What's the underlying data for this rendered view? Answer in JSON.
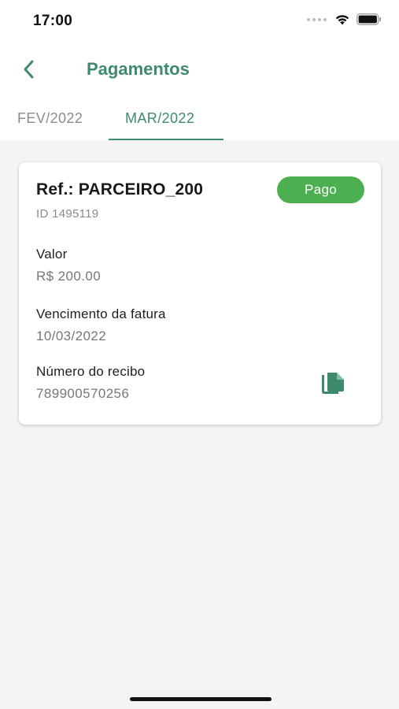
{
  "status_bar": {
    "time": "17:00"
  },
  "header": {
    "title": "Pagamentos"
  },
  "tabs": [
    {
      "label": "FEV/2022",
      "active": false
    },
    {
      "label": "MAR/2022",
      "active": true
    }
  ],
  "payment_card": {
    "reference": "Ref.: PARCEIRO_200",
    "id": "ID 1495119",
    "status": "Pago",
    "fields": [
      {
        "label": "Valor",
        "value": "R$ 200.00"
      },
      {
        "label": "Vencimento da fatura",
        "value": "10/03/2022"
      },
      {
        "label": "Número do recibo",
        "value": "789900570256"
      }
    ]
  },
  "colors": {
    "accent": "#3e8a6c",
    "status_paid": "#4caf50",
    "background": "#f4f4f4"
  },
  "icons": {
    "back": "chevron-left-icon",
    "copy": "copy-icon",
    "wifi": "wifi-icon",
    "battery": "battery-icon"
  }
}
